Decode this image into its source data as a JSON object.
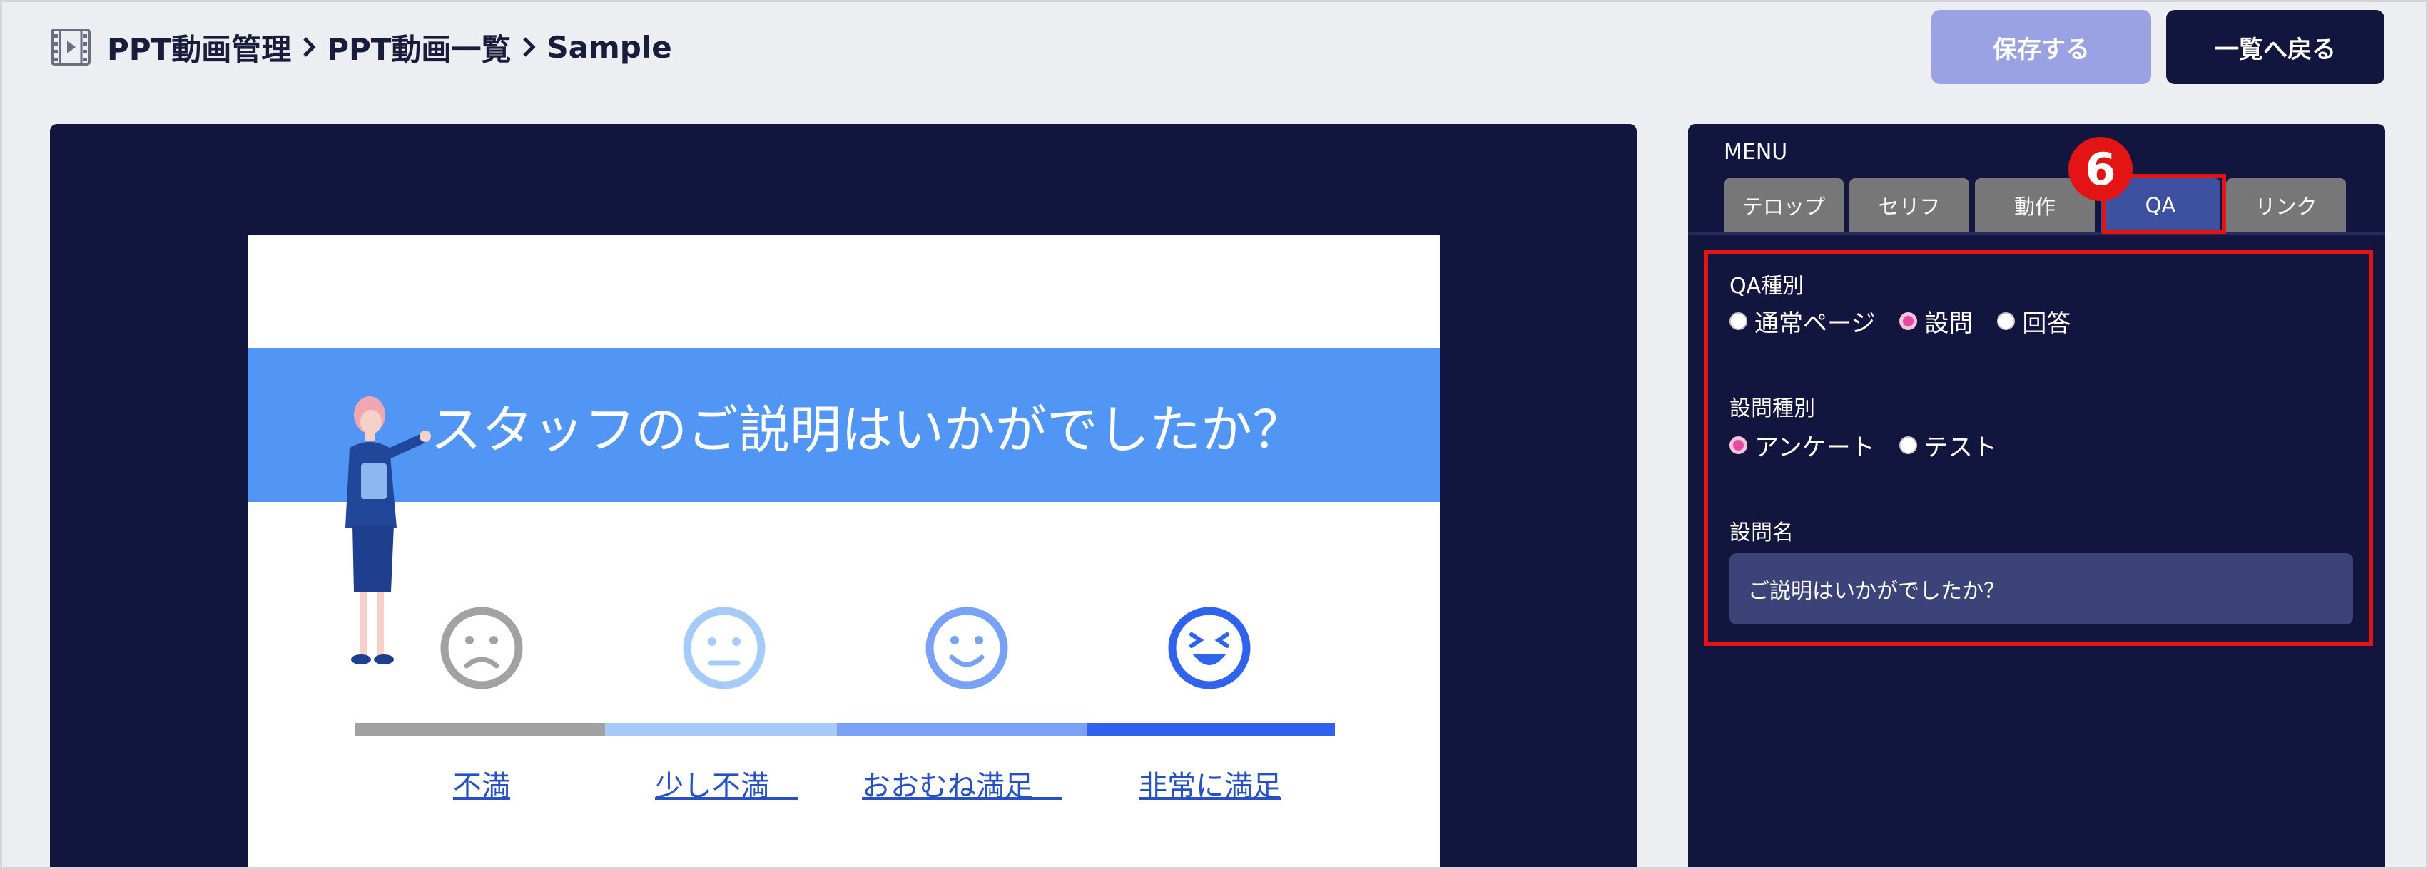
{
  "breadcrumb": {
    "items": [
      "PPT動画管理",
      "PPT動画一覧",
      "Sample"
    ]
  },
  "buttons": {
    "save": "保存する",
    "back": "一覧へ戻る"
  },
  "slide": {
    "question": "スタッフのご説明はいかがでしたか？",
    "scale": [
      {
        "label": "不満",
        "face": "frown-face-icon",
        "color": "#a2a2a2"
      },
      {
        "label": "少し不満　",
        "face": "neutral-face-icon",
        "color": "#a7cbf9"
      },
      {
        "label": "おおむね満足　",
        "face": "smile-face-icon",
        "color": "#79a1f5"
      },
      {
        "label": "非常に満足",
        "face": "grin-face-icon",
        "color": "#2f63ee"
      }
    ]
  },
  "menu": {
    "title": "MENU",
    "tabs": [
      "テロップ",
      "セリフ",
      "動作",
      "QA",
      "リンク"
    ],
    "active_tab": "QA",
    "step_badge": "6"
  },
  "qa": {
    "type_label": "QA種別",
    "type_options": [
      "通常ページ",
      "設問",
      "回答"
    ],
    "type_selected": "設問",
    "question_type_label": "設問種別",
    "question_type_options": [
      "アンケート",
      "テスト"
    ],
    "question_type_selected": "アンケート",
    "question_name_label": "設問名",
    "question_name_value": "ご説明はいかがでしたか？"
  },
  "colors": {
    "navy": "#12163f",
    "highlight": "#e21414",
    "save_disabled": "#9aa2e3",
    "banner": "#5296f5",
    "radio_selected": "#e94aa0"
  }
}
